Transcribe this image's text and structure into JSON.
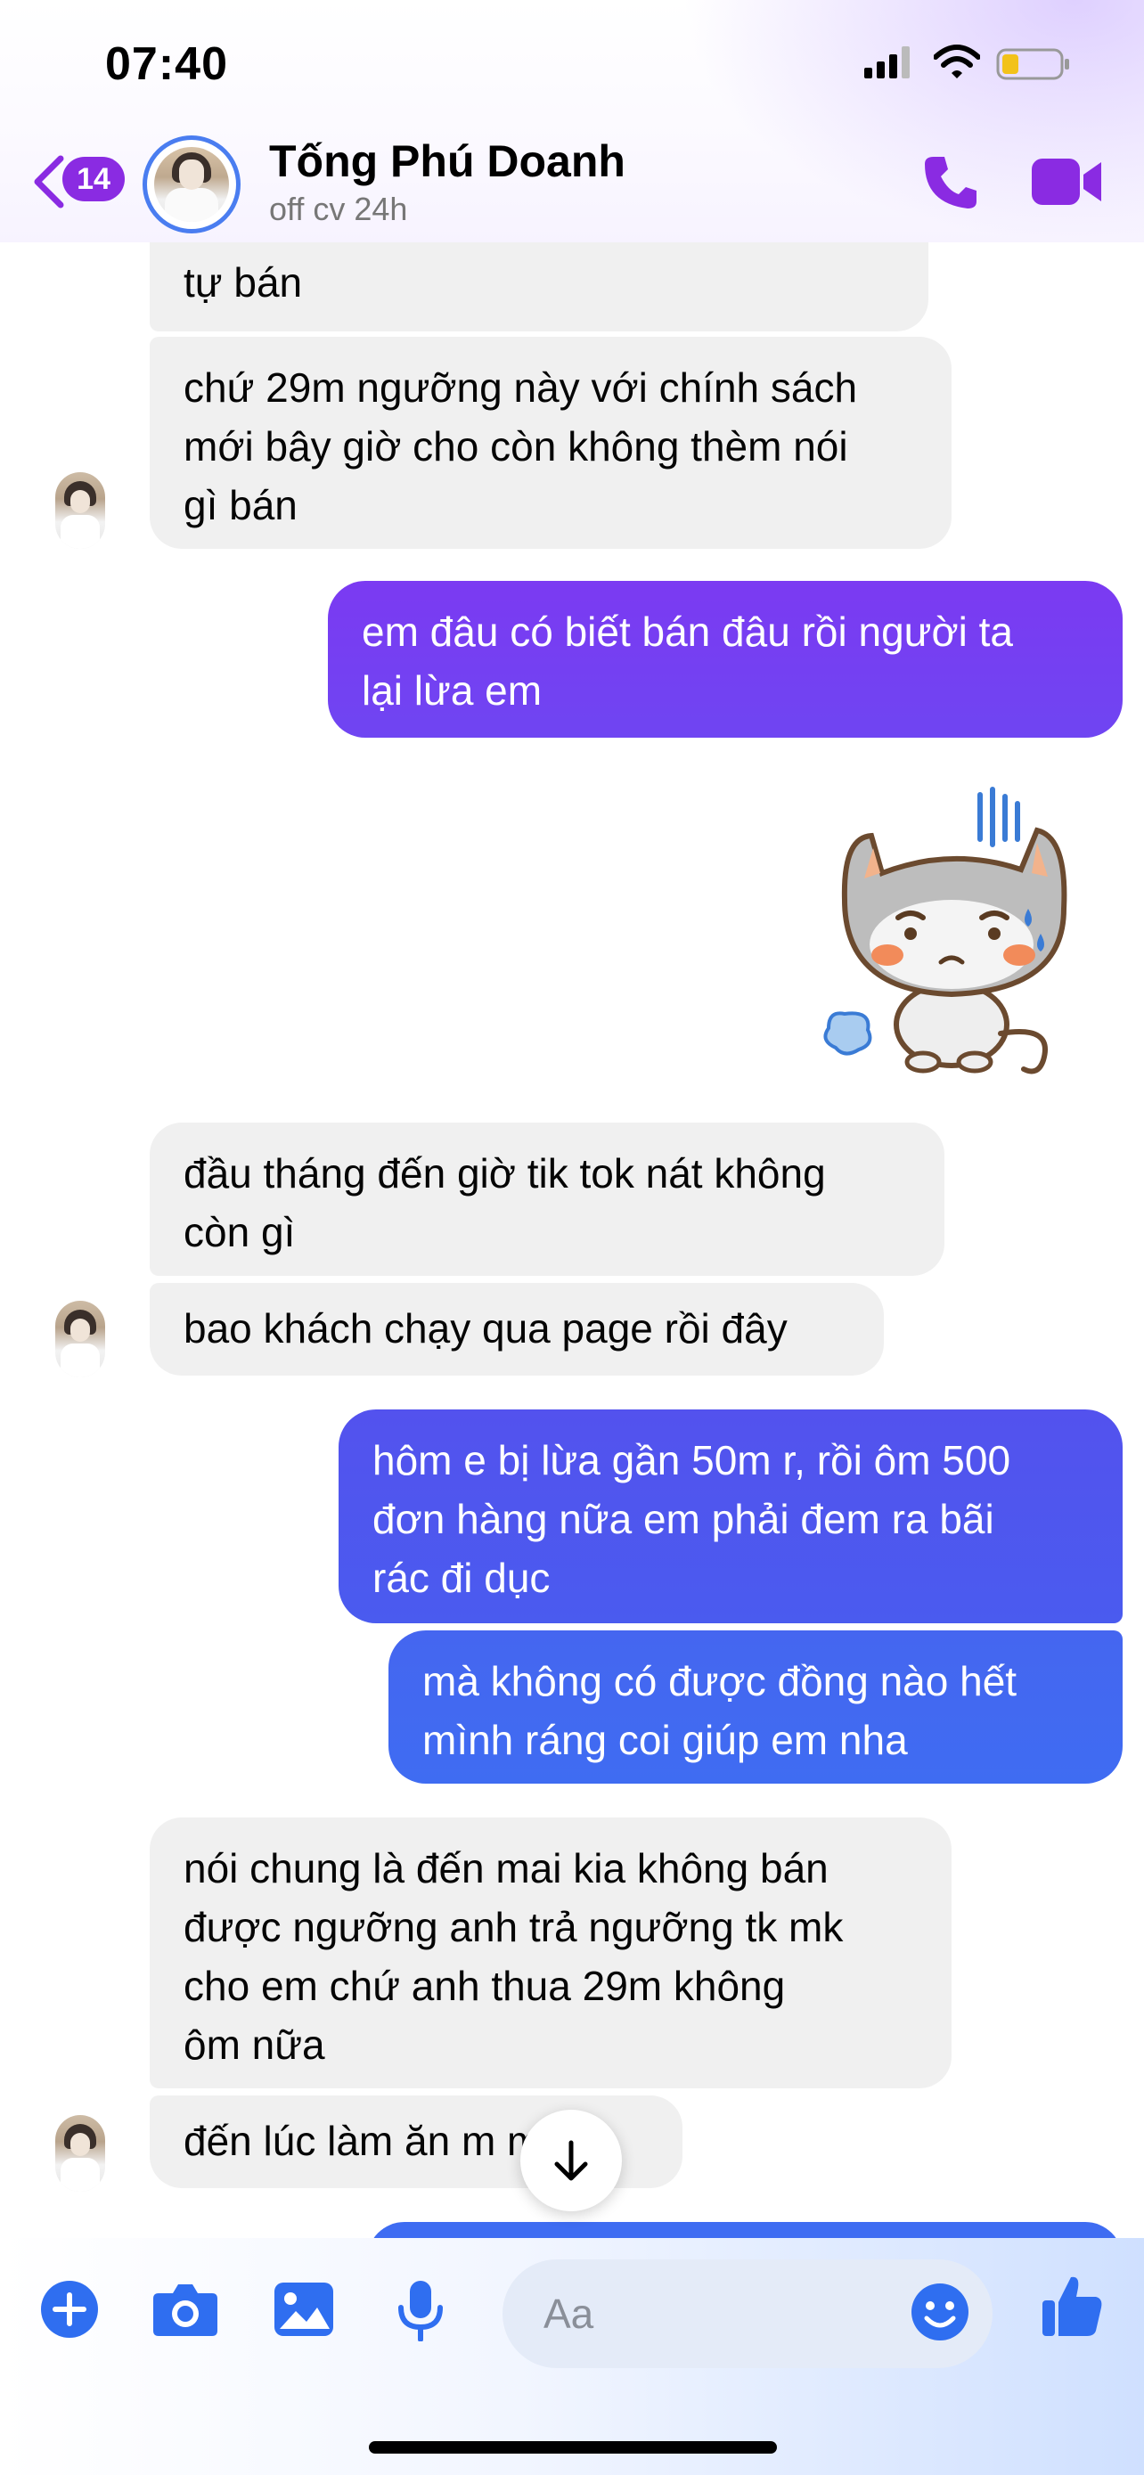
{
  "status_bar": {
    "time": "07:40",
    "battery_icon": "battery-low-icon"
  },
  "header": {
    "back_badge": "14",
    "contact_name": "Tống Phú Doanh",
    "contact_status": "off cv 24h",
    "colors": {
      "accent": "#8a2be2",
      "avatar_ring": "#4a7df0"
    }
  },
  "messages": [
    {
      "direction": "in",
      "text": "tự bán"
    },
    {
      "direction": "in",
      "text": "chứ 29m ngưỡng này với chính sách\nmới bây giờ cho còn không thèm nói\ngì bán"
    },
    {
      "direction": "out",
      "text": "em đâu có biết bán đâu rồi người ta\nlại lừa em"
    },
    {
      "direction": "out",
      "type": "sticker",
      "sticker_icon": "sad-cat-sticker-icon"
    },
    {
      "direction": "in",
      "text": "đầu tháng đến giờ tik tok nát không\ncòn gì"
    },
    {
      "direction": "in",
      "text": "bao khách chạy qua page rồi đây"
    },
    {
      "direction": "out",
      "text": "hôm e bị lừa gần 50m r, rồi ôm 500\nđơn hàng nữa em phải đem ra bãi\nrác đi dục"
    },
    {
      "direction": "out",
      "text": "mà không có được đồng nào hết\nmình ráng coi giúp em nha"
    },
    {
      "direction": "in",
      "text": "nói chung là đến  mai kia không bán\nđược ngưỡng anh trả ngưỡng tk mk\ncho em chứ anh thua 29m không\nôm nữa"
    },
    {
      "direction": "in",
      "text": "đến lúc làm ăn m        m"
    }
  ],
  "composer": {
    "placeholder": "Aa",
    "icons": [
      "plus-icon",
      "camera-icon",
      "image-icon",
      "microphone-icon",
      "emoji-icon",
      "thumbs-up-icon"
    ]
  },
  "colors": {
    "incoming_bubble": "#f0f0f0",
    "outgoing_purple": "#7a3cf0",
    "outgoing_blue": "#3d63f2"
  }
}
